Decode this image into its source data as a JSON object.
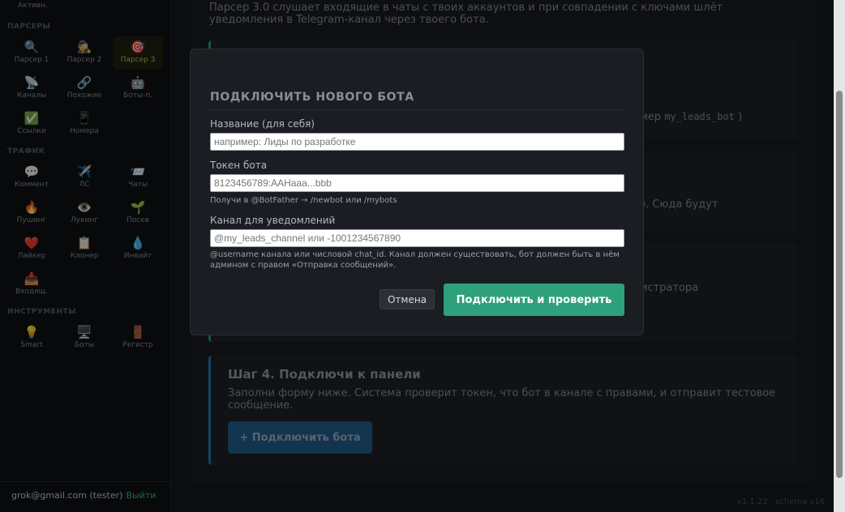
{
  "sidebar": {
    "top_label": "Активн.",
    "sections": {
      "parsers": "ПАРСЕРЫ",
      "traffic": "ТРАФИК",
      "tools": "ИНСТРУМЕНТЫ"
    },
    "parsers": [
      {
        "icon": "🔍",
        "icon_name": "magnifier-icon",
        "label": "Парсер 1"
      },
      {
        "icon": "🕵️",
        "icon_name": "detective-icon",
        "label": "Парсер 2"
      },
      {
        "icon": "🎯",
        "icon_name": "target-icon",
        "label": "Парсер 3",
        "active": true
      },
      {
        "icon": "📡",
        "icon_name": "antenna-icon",
        "label": "Каналы"
      },
      {
        "icon": "🔗",
        "icon_name": "link-icon",
        "label": "Похожие"
      },
      {
        "icon": "🤖",
        "icon_name": "robot-icon",
        "label": "Боты-п."
      },
      {
        "icon": "✅",
        "icon_name": "checkmark-icon",
        "label": "Ссылки"
      },
      {
        "icon": "📱",
        "icon_name": "phone-icon",
        "label": "Номера"
      }
    ],
    "traffic": [
      {
        "icon": "💬",
        "icon_name": "speech-bubble-icon",
        "label": "Коммент"
      },
      {
        "icon": "✈️",
        "icon_name": "airplane-icon",
        "label": "ЛС"
      },
      {
        "icon": "📨",
        "icon_name": "envelope-icon",
        "label": "Чаты"
      },
      {
        "icon": "🔥",
        "icon_name": "fire-icon",
        "label": "Пушинг"
      },
      {
        "icon": "👁️",
        "icon_name": "eye-icon",
        "label": "Лукинг"
      },
      {
        "icon": "🌱",
        "icon_name": "sprout-icon",
        "label": "Посев"
      },
      {
        "icon": "❤️",
        "icon_name": "heart-icon",
        "label": "Лайкер"
      },
      {
        "icon": "📋",
        "icon_name": "clipboard-icon",
        "label": "Клонер"
      },
      {
        "icon": "💧",
        "icon_name": "droplet-icon",
        "label": "Инвайт"
      },
      {
        "icon": "📥",
        "icon_name": "inbox-icon",
        "label": "Входящ."
      }
    ],
    "tools": [
      {
        "icon": "💡",
        "icon_name": "lightbulb-icon",
        "label": "Smart"
      },
      {
        "icon": "🖥️",
        "icon_name": "monitor-icon",
        "label": "Боты"
      },
      {
        "icon": "🚪",
        "icon_name": "door-icon",
        "label": "Регистр"
      }
    ],
    "user": "grok@gmail.com (tester)",
    "logout": "Выйти"
  },
  "main": {
    "intro": "Парсер 3.0 слушает входящие в чаты с твоих аккаунтов и при совпадении с ключами шлёт уведомления в Telegram-канал через твоего бота.",
    "bg_fragments": {
      "step1_tail_prefix": "мер",
      "step1_tail_code": "my_leads_bot",
      "step1_tail_suffix": ")",
      "step2_tail": "). Сюда будут",
      "step3_tail": "истратора"
    },
    "step4": {
      "title": "Шаг 4. Подключи к панели",
      "desc": "Заполни форму ниже. Система проверит токен, что бот в канале с правами, и отправит тестовое сообщение.",
      "button": "+ Подключить бота"
    },
    "version": "v1.1.22 · schema v16"
  },
  "modal": {
    "title": "ПОДКЛЮЧИТЬ НОВОГО БОТА",
    "name_label": "Название (для себя)",
    "name_placeholder": "например: Лиды по разработке",
    "token_label": "Токен бота",
    "token_placeholder": "8123456789:AAHaaa...bbb",
    "token_hint": "Получи в @BotFather → /newbot или /mybots",
    "channel_label": "Канал для уведомлений",
    "channel_placeholder": "@my_leads_channel или -1001234567890",
    "channel_hint": "@username канала или числовой chat_id. Канал должен существовать, бот должен быть в нём админом с правом «Отправка сообщений».",
    "cancel": "Отмена",
    "confirm": "Подключить и проверить"
  },
  "colors": {
    "accent_green": "#2ea07c",
    "accent_blue": "#235f8f",
    "active_item": "#b9c94d"
  }
}
